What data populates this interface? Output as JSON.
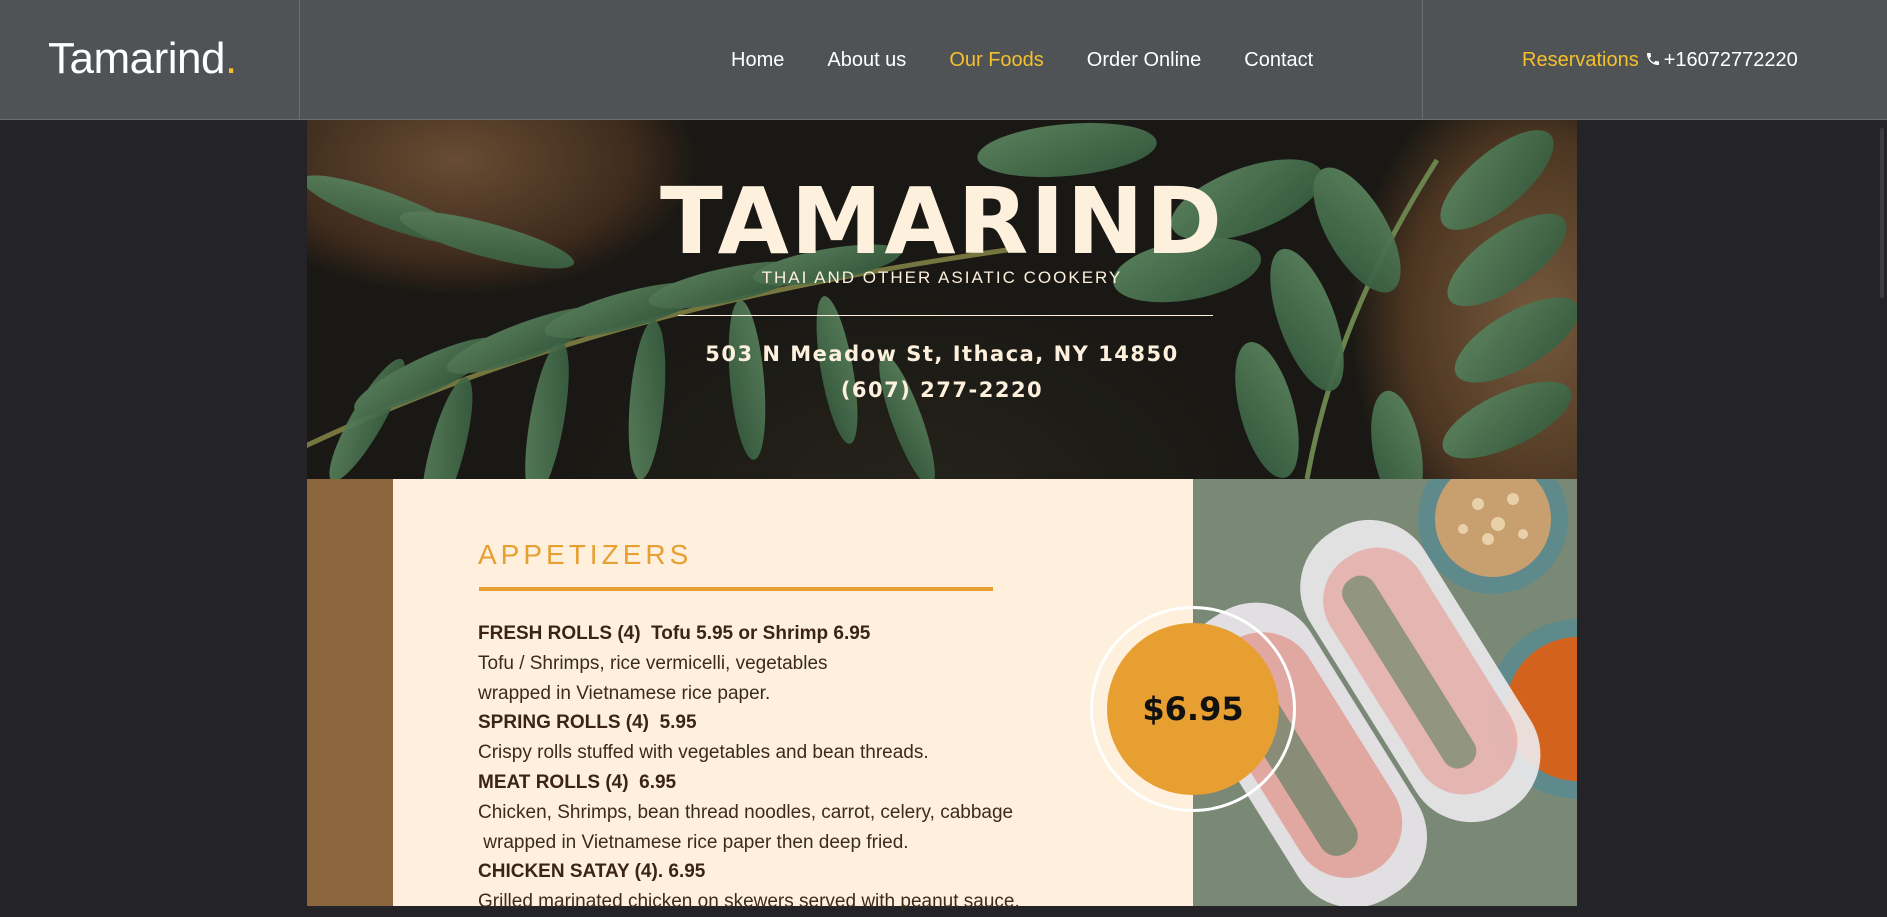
{
  "brand": {
    "logo_text": "Tamarind",
    "logo_dot": "."
  },
  "nav": {
    "items": [
      {
        "label": "Home",
        "active": false
      },
      {
        "label": "About us",
        "active": false
      },
      {
        "label": "Our Foods",
        "active": true
      },
      {
        "label": "Order Online",
        "active": false
      },
      {
        "label": "Contact",
        "active": false
      }
    ]
  },
  "reservations": {
    "label": "Reservations",
    "phone": "+16072772220",
    "icon": "phone-icon"
  },
  "hero": {
    "title": "TAMARIND",
    "subtitle": "THAI AND OTHER ASIATIC COOKERY",
    "address": "503 N Meadow St, Ithaca, NY 14850",
    "phone": "(607) 277-2220"
  },
  "menu": {
    "section_title": "APPETIZERS",
    "items": [
      {
        "name": "FRESH ROLLS (4)  Tofu 5.95 or Shrimp 6.95",
        "desc": [
          "Tofu / Shrimps, rice vermicelli, vegetables",
          "wrapped in Vietnamese rice paper."
        ]
      },
      {
        "name": "SPRING ROLLS (4)  5.95",
        "desc": [
          "Crispy rolls stuffed with vegetables and bean threads."
        ]
      },
      {
        "name": "MEAT ROLLS (4)  6.95",
        "desc": [
          "Chicken, Shrimps, bean thread noodles, carrot, celery, cabbage",
          " wrapped in Vietnamese rice paper then deep fried."
        ]
      },
      {
        "name": "CHICKEN SATAY (4). 6.95",
        "desc": [
          "Grilled marinated chicken on skewers served with peanut sauce."
        ]
      }
    ]
  },
  "price_badge": "$6.95",
  "colors": {
    "accent": "#f5c02a",
    "menu_orange": "#e79f32",
    "header_bg": "#4f5356",
    "panel_bg": "#fef0dd",
    "strip_brown": "#8b653d"
  }
}
